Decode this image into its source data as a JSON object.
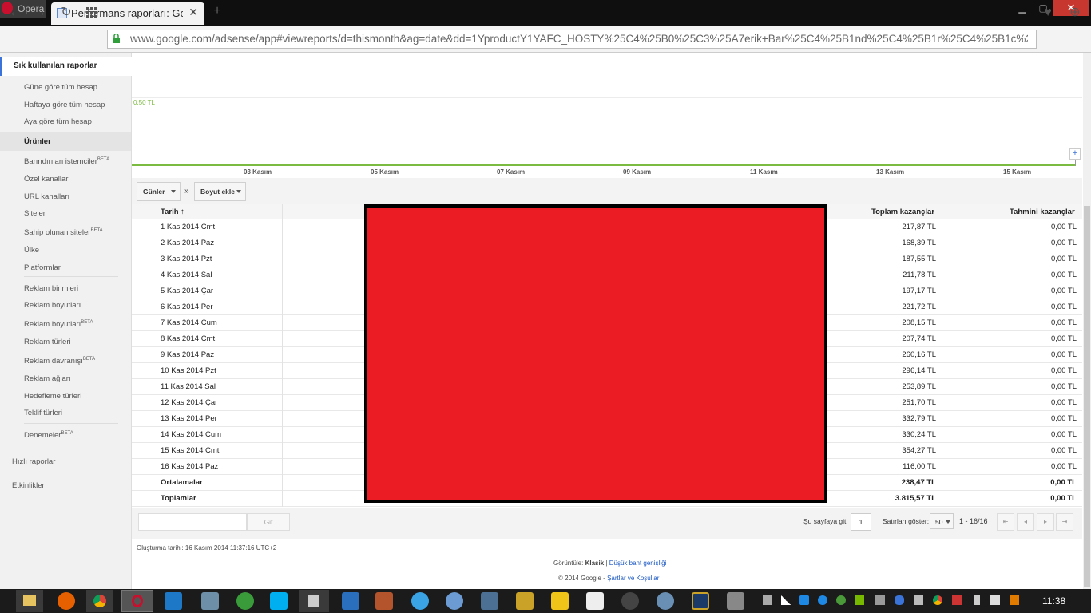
{
  "browser": {
    "app_label": "Opera",
    "tab_title": "Performans raporları: Goo",
    "tab_close": "✕",
    "new_tab": "+",
    "url": "www.google.com/adsense/app#viewreports/d=thismonth&ag=date&dd=1YproductY1YAFC_HOSTY%25C4%25B0%25C3%25A7erik+Bar%25C4%25B1nd%25C4%25B1r%25C4%25B1c%25C4%25B1"
  },
  "sidebar": {
    "head": "Sık kullanılan raporlar",
    "items_frequent": [
      "Güne göre tüm hesap",
      "Haftaya göre tüm hesap",
      "Aya göre tüm hesap"
    ],
    "section": "Ürünler",
    "items": [
      "Barındırılan istemciler",
      "Özel kanallar",
      "URL kanalları",
      "Siteler",
      "Sahip olunan siteler",
      "Ülke",
      "Platformlar",
      "Reklam birimleri",
      "Reklam boyutları",
      "Reklam boyutları",
      "Reklam türleri",
      "Reklam davranışı",
      "Reklam ağları",
      "Hedefleme türleri",
      "Teklif türleri",
      "Denemeler"
    ],
    "beta": "BETA",
    "quick": "Hızlı raporlar",
    "activities": "Etkinlikler"
  },
  "chart": {
    "ylabel": "0,50 TL",
    "dates": [
      "03 Kasım",
      "05 Kasım",
      "07 Kasım",
      "09 Kasım",
      "11 Kasım",
      "13 Kasım",
      "15 Kasım"
    ],
    "expand": "+"
  },
  "filters": {
    "group_by": "Günler",
    "arrow": "»",
    "add_dim": "Boyut ekle"
  },
  "table": {
    "col_date": "Tarih",
    "col_total": "Toplam kazançlar",
    "col_est": "Tahmini kazançlar",
    "rows": [
      {
        "date": "1 Kas 2014 Cmt",
        "total": "217,87 TL",
        "est": "0,00 TL"
      },
      {
        "date": "2 Kas 2014 Paz",
        "total": "168,39 TL",
        "est": "0,00 TL"
      },
      {
        "date": "3 Kas 2014 Pzt",
        "total": "187,55 TL",
        "est": "0,00 TL"
      },
      {
        "date": "4 Kas 2014 Sal",
        "total": "211,78 TL",
        "est": "0,00 TL"
      },
      {
        "date": "5 Kas 2014 Çar",
        "total": "197,17 TL",
        "est": "0,00 TL"
      },
      {
        "date": "6 Kas 2014 Per",
        "total": "221,72 TL",
        "est": "0,00 TL"
      },
      {
        "date": "7 Kas 2014 Cum",
        "total": "208,15 TL",
        "est": "0,00 TL"
      },
      {
        "date": "8 Kas 2014 Cmt",
        "total": "207,74 TL",
        "est": "0,00 TL"
      },
      {
        "date": "9 Kas 2014 Paz",
        "total": "260,16 TL",
        "est": "0,00 TL"
      },
      {
        "date": "10 Kas 2014 Pzt",
        "total": "296,14 TL",
        "est": "0,00 TL"
      },
      {
        "date": "11 Kas 2014 Sal",
        "total": "253,89 TL",
        "est": "0,00 TL"
      },
      {
        "date": "12 Kas 2014 Çar",
        "total": "251,70 TL",
        "est": "0,00 TL"
      },
      {
        "date": "13 Kas 2014 Per",
        "total": "332,79 TL",
        "est": "0,00 TL"
      },
      {
        "date": "14 Kas 2014 Cum",
        "total": "330,24 TL",
        "est": "0,00 TL"
      },
      {
        "date": "15 Kas 2014 Cmt",
        "total": "354,27 TL",
        "est": "0,00 TL"
      },
      {
        "date": "16 Kas 2014 Paz",
        "total": "116,00 TL",
        "est": "0,00 TL"
      }
    ],
    "avg": {
      "date": "Ortalamalar",
      "total": "238,47 TL",
      "est": "0,00 TL"
    },
    "sum": {
      "date": "Toplamlar",
      "total": "3.815,57 TL",
      "est": "0,00 TL"
    }
  },
  "pager": {
    "go_btn": "Git",
    "go_page_label": "Şu sayfaya git:",
    "page_value": "1",
    "rows_label": "Satırları göster:",
    "rows_value": "50",
    "range": "1 - 16/16"
  },
  "footer": {
    "created": "Oluşturma tarihi: 16 Kasım 2014 11:37:16 UTC+2",
    "view_label": "Görüntüle:",
    "view_classic": "Klasik",
    "sep": "|",
    "view_low": "Düşük bant genişliği",
    "copyright": "© 2014 Google -",
    "terms": "Şartlar ve Koşullar"
  },
  "taskbar": {
    "clock": "11:38"
  },
  "colors": {
    "accent_green": "#7cbb42",
    "link_blue": "#1a57c2",
    "redaction": "#ec1c24"
  }
}
